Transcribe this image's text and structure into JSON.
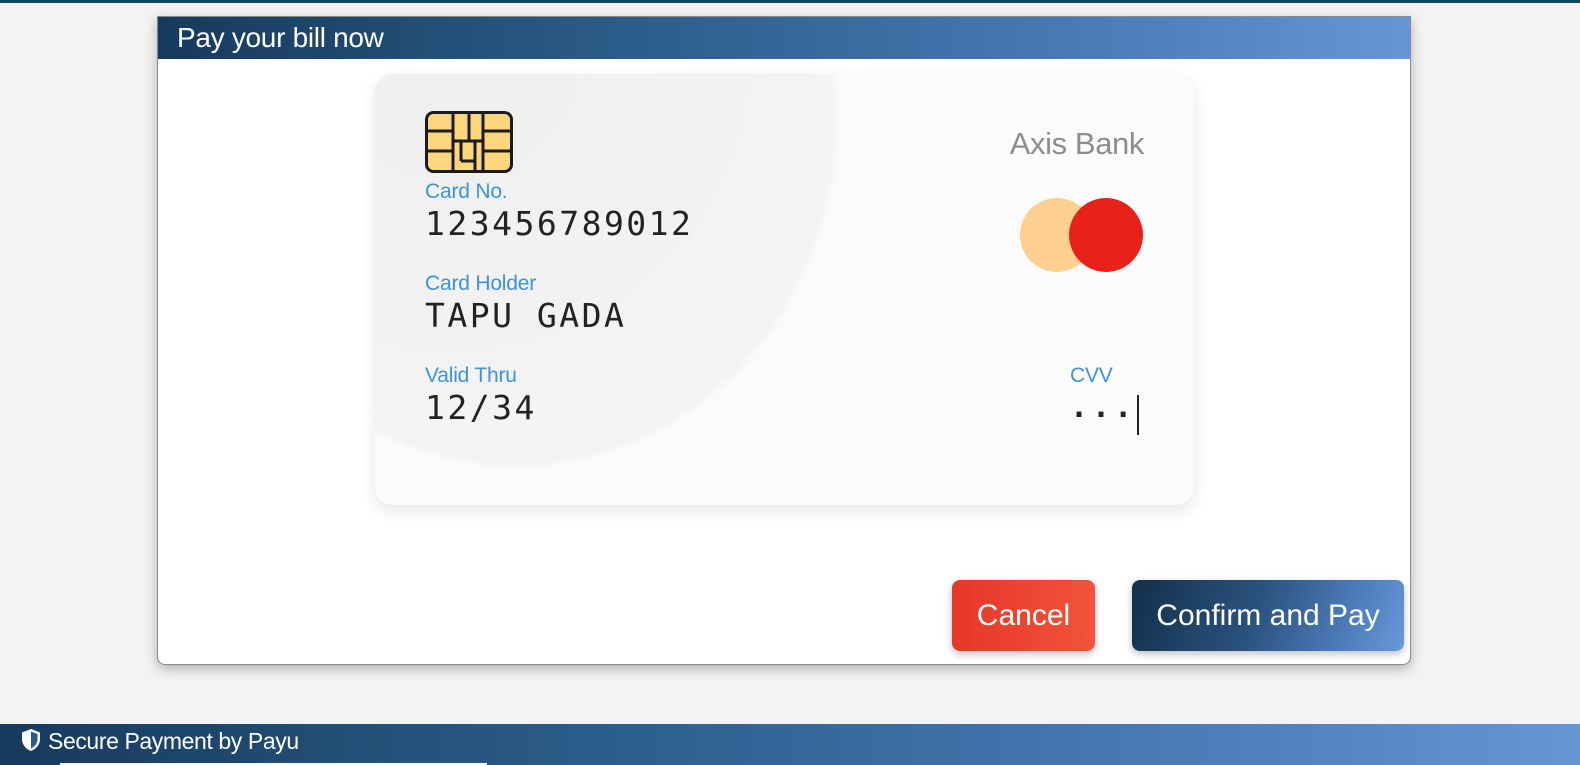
{
  "page": {
    "footer_text": "Secure Payment by Payu"
  },
  "modal": {
    "title": "Pay your bill now"
  },
  "card": {
    "bank_name": "Axis Bank",
    "number_label": "Card No.",
    "number_value": "123456789012",
    "holder_label": "Card Holder",
    "holder_value": "TAPU GADA",
    "valid_label": "Valid Thru",
    "valid_value": "12/34",
    "cvv_label": "CVV",
    "cvv_masked": "···",
    "network": "mastercard-logo",
    "chip_icon": "chip-icon"
  },
  "actions": {
    "cancel_label": "Cancel",
    "confirm_label": "Confirm and Pay"
  },
  "colors": {
    "accent_label": "#3d93db",
    "header_gradient_start": "#173a5c",
    "header_gradient_end": "#6596d6",
    "cancel": "#e6372a",
    "mastercard_left": "#fdd08f",
    "mastercard_right": "#e8221b"
  }
}
